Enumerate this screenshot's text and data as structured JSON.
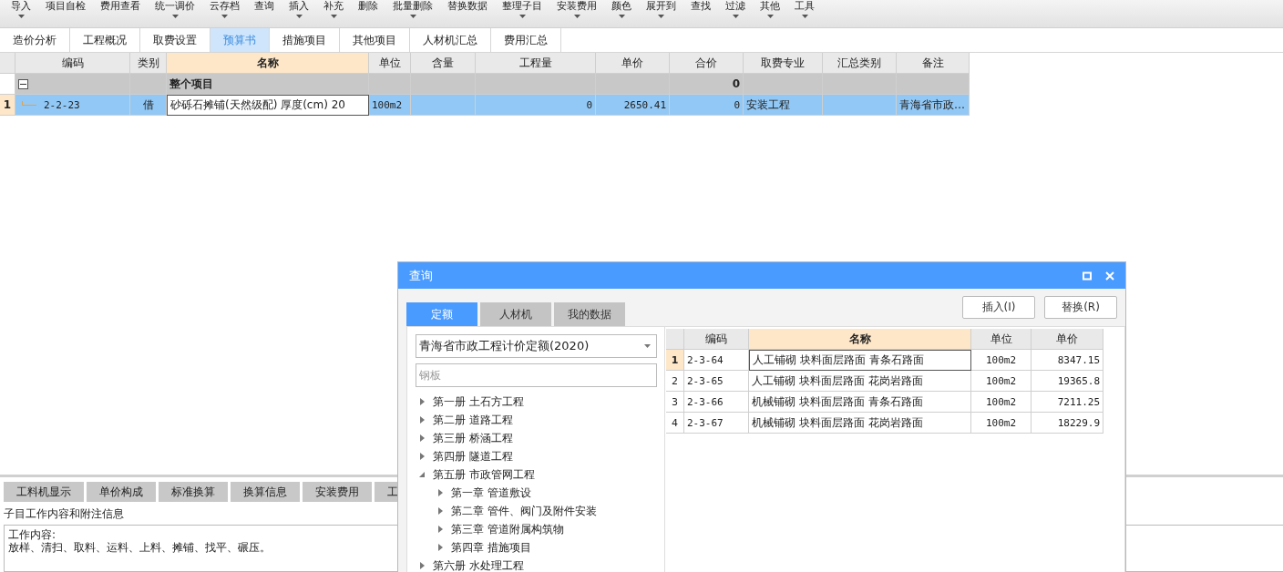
{
  "toolbar": [
    {
      "label": "导入",
      "dropdown": true
    },
    {
      "label": "项目自检",
      "dropdown": false
    },
    {
      "label": "费用查看",
      "dropdown": false
    },
    {
      "label": "统一调价",
      "dropdown": true
    },
    {
      "label": "云存档",
      "dropdown": true
    },
    {
      "label": "查询",
      "dropdown": false
    },
    {
      "label": "插入",
      "dropdown": true
    },
    {
      "label": "补充",
      "dropdown": true
    },
    {
      "label": "删除",
      "dropdown": false
    },
    {
      "label": "批量删除",
      "dropdown": true
    },
    {
      "label": "替换数据",
      "dropdown": false
    },
    {
      "label": "整理子目",
      "dropdown": true
    },
    {
      "label": "安装费用",
      "dropdown": true
    },
    {
      "label": "颜色",
      "dropdown": true
    },
    {
      "label": "展开到",
      "dropdown": true
    },
    {
      "label": "查找",
      "dropdown": false
    },
    {
      "label": "过滤",
      "dropdown": true
    },
    {
      "label": "其他",
      "dropdown": true
    },
    {
      "label": "工具",
      "dropdown": true
    }
  ],
  "tabs": [
    {
      "label": "造价分析",
      "selected": false
    },
    {
      "label": "工程概况",
      "selected": false
    },
    {
      "label": "取费设置",
      "selected": false
    },
    {
      "label": "预算书",
      "selected": true
    },
    {
      "label": "措施项目",
      "selected": false
    },
    {
      "label": "其他项目",
      "selected": false
    },
    {
      "label": "人材机汇总",
      "selected": false
    },
    {
      "label": "费用汇总",
      "selected": false
    }
  ],
  "table": {
    "columns": [
      "编码",
      "类别",
      "名称",
      "单位",
      "含量",
      "工程量",
      "单价",
      "合价",
      "取费专业",
      "汇总类别",
      "备注"
    ],
    "group": {
      "expanded": true,
      "name": "整个项目",
      "total": "0"
    },
    "rows": [
      {
        "index": "1",
        "selected": true,
        "cells": [
          "2-2-23",
          "借",
          "砂砾石摊铺(天然级配) 厚度(cm) 20",
          "100m2",
          "",
          "0",
          "2650.41",
          "0",
          "安装工程",
          "",
          "青海省市政…"
        ]
      }
    ]
  },
  "bottom_tabs": [
    "工料机显示",
    "单价构成",
    "标准换算",
    "换算信息",
    "安装费用",
    "工"
  ],
  "notes": {
    "title": "子目工作内容和附注信息",
    "lines": [
      "工作内容:",
      "放样、清扫、取料、运料、上料、摊铺、找平、碾压。"
    ]
  },
  "dialog": {
    "title": "查询",
    "tabs": [
      {
        "label": "定额",
        "selected": true
      },
      {
        "label": "人材机",
        "selected": false
      },
      {
        "label": "我的数据",
        "selected": false
      }
    ],
    "buttons": [
      "插入(I)",
      "替换(R)"
    ],
    "library": "青海省市政工程计价定额(2020)",
    "search": {
      "placeholder": "钢板"
    },
    "tree": [
      {
        "label": "第一册 土石方工程",
        "expanded": false
      },
      {
        "label": "第二册 道路工程",
        "expanded": false
      },
      {
        "label": "第三册 桥涵工程",
        "expanded": false
      },
      {
        "label": "第四册 隧道工程",
        "expanded": false
      },
      {
        "label": "第五册 市政管网工程",
        "expanded": true,
        "children": [
          {
            "label": "第一章 管道敷设",
            "expanded": false
          },
          {
            "label": "第二章 管件、阀门及附件安装",
            "expanded": false
          },
          {
            "label": "第三章 管道附属构筑物",
            "expanded": false
          },
          {
            "label": "第四章 措施项目",
            "expanded": false
          }
        ]
      },
      {
        "label": "第六册 水处理工程",
        "expanded": false
      }
    ],
    "results": {
      "columns": [
        "编码",
        "名称",
        "单位",
        "单价"
      ],
      "rows": [
        {
          "index": "1",
          "selected": true,
          "cells": [
            "2-3-64",
            "人工铺砌 块料面层路面 青条石路面",
            "100m2",
            "8347.15"
          ]
        },
        {
          "index": "2",
          "selected": false,
          "cells": [
            "2-3-65",
            "人工铺砌 块料面层路面 花岗岩路面",
            "100m2",
            "19365.8"
          ]
        },
        {
          "index": "3",
          "selected": false,
          "cells": [
            "2-3-66",
            "机械铺砌 块料面层路面 青条石路面",
            "100m2",
            "7211.25"
          ]
        },
        {
          "index": "4",
          "selected": false,
          "cells": [
            "2-3-67",
            "机械铺砌 块料面层路面 花岗岩路面",
            "100m2",
            "18229.9"
          ]
        }
      ]
    }
  }
}
